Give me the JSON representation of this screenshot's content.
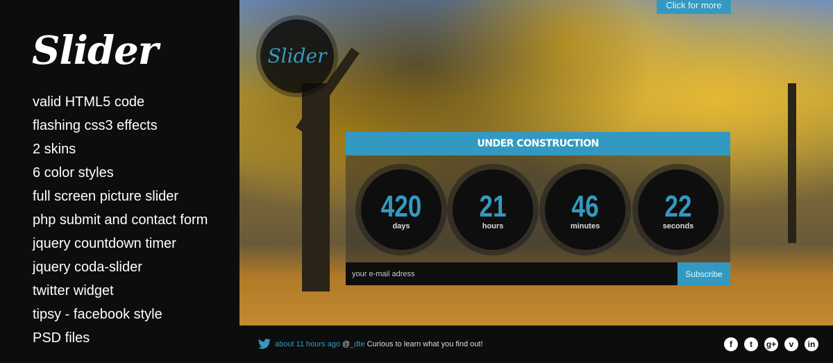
{
  "sidebar": {
    "logo": "Slider",
    "features": [
      "valid HTML5 code",
      "flashing css3 effects",
      "2 skins",
      "6 color styles",
      "full screen picture slider",
      "php submit and contact form",
      "jquery countdown timer",
      "jquery coda-slider",
      "twitter widget",
      "tipsy - facebook style",
      "PSD files"
    ]
  },
  "hero": {
    "more_label": "Click for more",
    "badge_logo": "Slider"
  },
  "countdown": {
    "title": "UNDER CONSTRUCTION",
    "units": [
      {
        "value": "420",
        "label": "days"
      },
      {
        "value": "21",
        "label": "hours"
      },
      {
        "value": "46",
        "label": "minutes"
      },
      {
        "value": "22",
        "label": "seconds"
      }
    ]
  },
  "subscribe": {
    "placeholder": "your e-mail adress",
    "button": "Subscribe"
  },
  "twitter": {
    "time": "about 11 hours ago",
    "at": "@",
    "handle": "_dte",
    "message": "Curious to learn what you find out!"
  },
  "social": [
    {
      "icon": "facebook-icon",
      "glyph": "f"
    },
    {
      "icon": "twitter-icon",
      "glyph": "t"
    },
    {
      "icon": "google-plus-icon",
      "glyph": "g+"
    },
    {
      "icon": "vimeo-icon",
      "glyph": "v"
    },
    {
      "icon": "linkedin-icon",
      "glyph": "in"
    }
  ],
  "colors": {
    "accent": "#3399c1",
    "background": "#0d0d0d"
  }
}
